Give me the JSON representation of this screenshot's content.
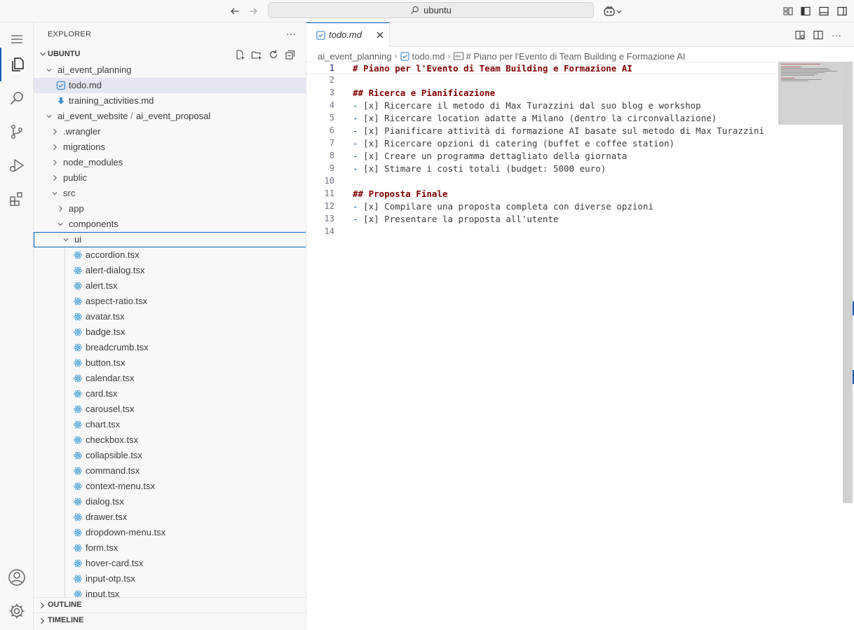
{
  "titlebar": {
    "search_text": "ubuntu"
  },
  "sidebar": {
    "title": "EXPLORER",
    "more": "···",
    "workspace": "UBUNTU",
    "tree": [
      {
        "label": "ai_event_planning",
        "kind": "folder-open"
      },
      {
        "label": "todo.md",
        "kind": "md-check"
      },
      {
        "label": "training_activities.md",
        "kind": "md-down"
      },
      {
        "label": "ai_event_website",
        "kind": "folder-open"
      },
      {
        "label": ".wrangler",
        "kind": "folder"
      },
      {
        "label": "migrations",
        "kind": "folder"
      },
      {
        "label": "node_modules",
        "kind": "folder"
      },
      {
        "label": "public",
        "kind": "folder"
      },
      {
        "label": "src",
        "kind": "folder-open"
      },
      {
        "label": "app",
        "kind": "folder"
      },
      {
        "label": "components",
        "kind": "folder-open"
      },
      {
        "label": "ui",
        "kind": "folder-open"
      },
      {
        "label": "accordion.tsx",
        "kind": "react"
      },
      {
        "label": "alert-dialog.tsx",
        "kind": "react"
      },
      {
        "label": "alert.tsx",
        "kind": "react"
      },
      {
        "label": "aspect-ratio.tsx",
        "kind": "react"
      },
      {
        "label": "avatar.tsx",
        "kind": "react"
      },
      {
        "label": "badge.tsx",
        "kind": "react"
      },
      {
        "label": "breadcrumb.tsx",
        "kind": "react"
      },
      {
        "label": "button.tsx",
        "kind": "react"
      },
      {
        "label": "calendar.tsx",
        "kind": "react"
      },
      {
        "label": "card.tsx",
        "kind": "react"
      },
      {
        "label": "carousel.tsx",
        "kind": "react"
      },
      {
        "label": "chart.tsx",
        "kind": "react"
      },
      {
        "label": "checkbox.tsx",
        "kind": "react"
      },
      {
        "label": "collapsible.tsx",
        "kind": "react"
      },
      {
        "label": "command.tsx",
        "kind": "react"
      },
      {
        "label": "context-menu.tsx",
        "kind": "react"
      },
      {
        "label": "dialog.tsx",
        "kind": "react"
      },
      {
        "label": "drawer.tsx",
        "kind": "react"
      },
      {
        "label": "dropdown-menu.tsx",
        "kind": "react"
      },
      {
        "label": "form.tsx",
        "kind": "react"
      },
      {
        "label": "hover-card.tsx",
        "kind": "react"
      },
      {
        "label": "input-otp.tsx",
        "kind": "react"
      },
      {
        "label": "input.tsx",
        "kind": "react"
      }
    ],
    "compact_suffix": "ai_event_proposal",
    "compact_sep": "/",
    "outline": "OUTLINE",
    "timeline": "TIMELINE"
  },
  "editor": {
    "tab_label": "todo.md",
    "breadcrumb": {
      "folder": "ai_event_planning",
      "file": "todo.md",
      "symbol": "# Piano per l'Evento di Team Building e Formazione AI"
    },
    "lines": [
      {
        "n": "1",
        "type": "h",
        "text": "# Piano per l'Evento di Team Building e Formazione AI"
      },
      {
        "n": "2",
        "type": "blank",
        "text": ""
      },
      {
        "n": "3",
        "type": "h",
        "text": "## Ricerca e Pianificazione"
      },
      {
        "n": "4",
        "type": "item",
        "text": "[x] Ricercare il metodo di Max Turazzini dal suo blog e workshop"
      },
      {
        "n": "5",
        "type": "item",
        "text": "[x] Ricercare location adatte a Milano (dentro la circonvallazione)"
      },
      {
        "n": "6",
        "type": "item",
        "text": "[x] Pianificare attività di formazione AI basate sul metodo di Max Turazzini"
      },
      {
        "n": "7",
        "type": "item",
        "text": "[x] Ricercare opzioni di catering (buffet e coffee station)"
      },
      {
        "n": "8",
        "type": "item",
        "text": "[x] Creare un programma dettagliato della giornata"
      },
      {
        "n": "9",
        "type": "item",
        "text": "[x] Stimare i costi totali (budget: 5000 euro)"
      },
      {
        "n": "10",
        "type": "blank",
        "text": ""
      },
      {
        "n": "11",
        "type": "h",
        "text": "## Proposta Finale"
      },
      {
        "n": "12",
        "type": "item",
        "text": "[x] Compilare una proposta completa con diverse opzioni"
      },
      {
        "n": "13",
        "type": "item",
        "text": "[x] Presentare la proposta all'utente"
      },
      {
        "n": "14",
        "type": "blank",
        "text": ""
      }
    ],
    "item_prefix": "- "
  },
  "colors": {
    "accent": "#005fb8",
    "heading": "#800000",
    "list_marker": "#0451a5",
    "selection": "#e4e6f1"
  }
}
